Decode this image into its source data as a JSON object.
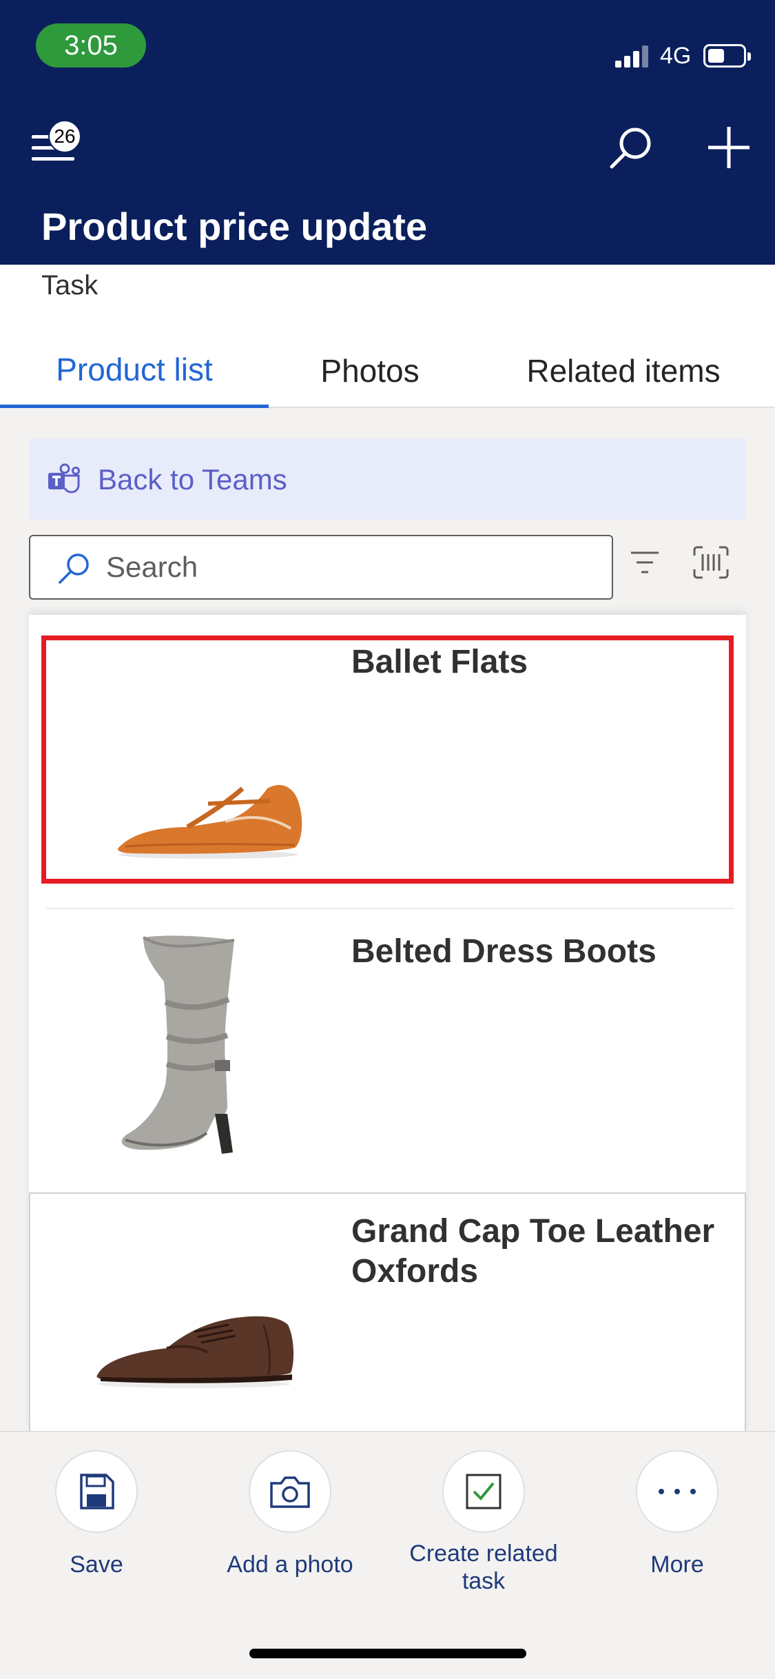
{
  "status_bar": {
    "time": "3:05",
    "network": "4G",
    "battery_level": 0.45
  },
  "header": {
    "notification_count": "26",
    "title": "Product price update",
    "icons": [
      "hamburger-menu-icon",
      "search-icon",
      "plus-icon"
    ]
  },
  "entity_label": "Task",
  "tabs": [
    {
      "label": "Product list",
      "active": true
    },
    {
      "label": "Photos",
      "active": false
    },
    {
      "label": "Related items",
      "active": false
    }
  ],
  "teams_bar": {
    "label": "Back to Teams",
    "icon": "teams-icon"
  },
  "search": {
    "placeholder": "Search",
    "value": ""
  },
  "products": [
    {
      "name": "Ballet Flats",
      "image": "orange-flat-shoe",
      "highlighted": true,
      "highlight_color": "#e51c23"
    },
    {
      "name": "Belted Dress Boots",
      "image": "grey-heeled-boot",
      "highlighted": false
    },
    {
      "name": "Grand Cap Toe Leather Oxfords",
      "image": "brown-oxford-shoe",
      "highlighted": false
    }
  ],
  "actions": [
    {
      "label": "Save",
      "icon": "save-icon"
    },
    {
      "label": "Add a photo",
      "icon": "camera-icon"
    },
    {
      "label": "Create related task",
      "icon": "checkbox-icon"
    },
    {
      "label": "More",
      "icon": "more-icon"
    }
  ],
  "colors": {
    "header_bg": "#0a1f5c",
    "accent": "#2266d4",
    "teams": "#5b5fc7",
    "time_pill": "#2e9a3c"
  }
}
